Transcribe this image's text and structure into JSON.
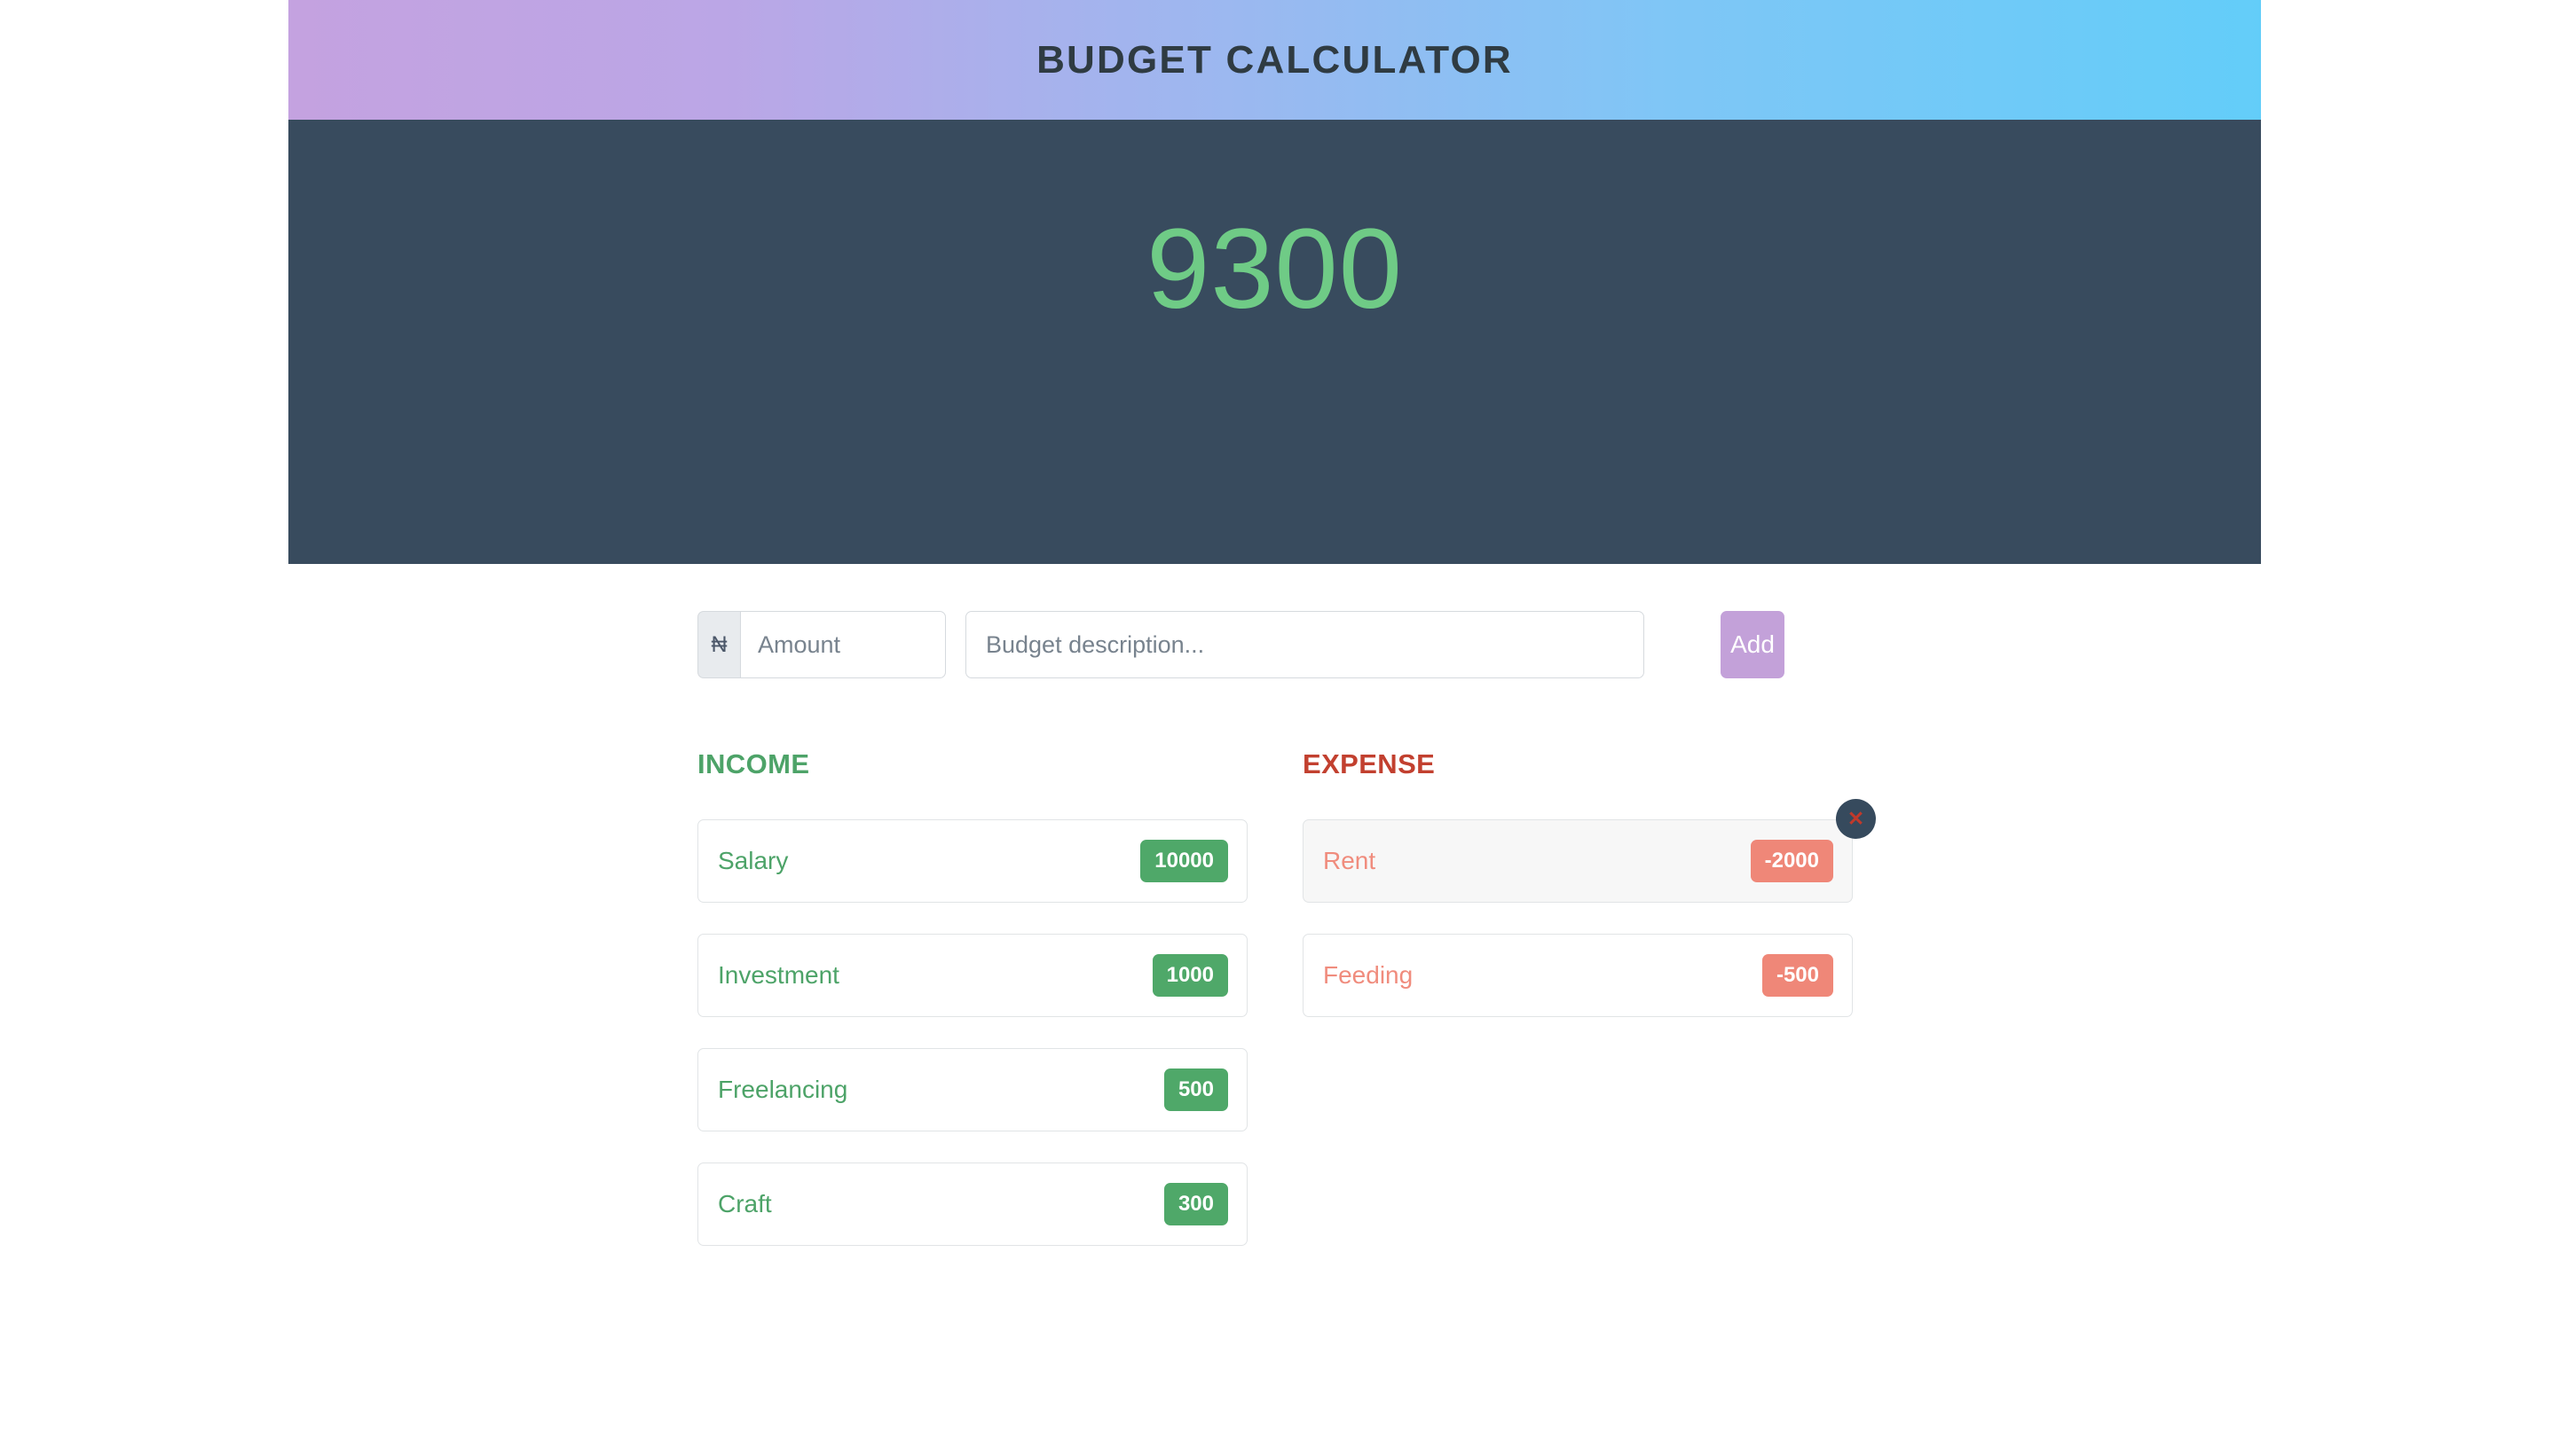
{
  "header": {
    "title": "BUDGET CALCULATOR"
  },
  "balance": {
    "value": "9300"
  },
  "form": {
    "currency_symbol": "₦",
    "amount_placeholder": "Amount",
    "amount_value": "",
    "description_placeholder": "Budget description...",
    "description_value": "",
    "add_label": "Add"
  },
  "income": {
    "title": "INCOME",
    "items": [
      {
        "label": "Salary",
        "amount": "10000"
      },
      {
        "label": "Investment",
        "amount": "1000"
      },
      {
        "label": "Freelancing",
        "amount": "500"
      },
      {
        "label": "Craft",
        "amount": "300"
      }
    ]
  },
  "expense": {
    "title": "EXPENSE",
    "items": [
      {
        "label": "Rent",
        "amount": "-2000"
      },
      {
        "label": "Feeding",
        "amount": "-500"
      }
    ]
  },
  "delete_button": {
    "glyph": "✕"
  },
  "colors": {
    "header_gradient_start": "#c4a2e0",
    "header_gradient_end": "#63cdf9",
    "balance_panel": "#384b5e",
    "balance_text": "#6fcb86",
    "income_accent": "#4da368",
    "expense_accent": "#c2402f",
    "income_badge": "#4fa869",
    "expense_badge": "#ef8778",
    "add_button": "#c3a1d9",
    "delete_circle": "#364a5d",
    "delete_glyph": "#c0392b"
  }
}
